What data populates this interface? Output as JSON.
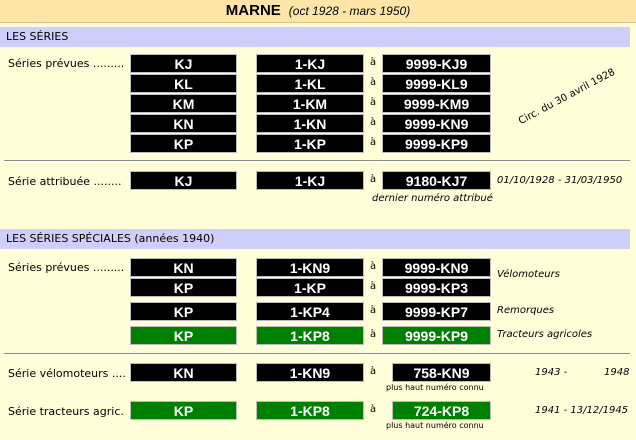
{
  "header": {
    "title": "MARNE",
    "dates": "(oct 1928 - mars 1950)"
  },
  "section1": {
    "heading": "LES SÉRIES",
    "series_prevues_label": "Séries prévues .........",
    "rows": [
      {
        "serie": "KJ",
        "from": "1-KJ",
        "a": "à",
        "to": "9999-KJ9"
      },
      {
        "serie": "KL",
        "from": "1-KL",
        "a": "à",
        "to": "9999-KL9"
      },
      {
        "serie": "KM",
        "from": "1-KM",
        "a": "à",
        "to": "9999-KM9"
      },
      {
        "serie": "KN",
        "from": "1-KN",
        "a": "à",
        "to": "9999-KN9"
      },
      {
        "serie": "KP",
        "from": "1-KP",
        "a": "à",
        "to": "9999-KP9"
      }
    ],
    "circ_note": "Circ. du 30 avril 1928",
    "attribuee_label": "Série attribuée ........",
    "attribuee": {
      "serie": "KJ",
      "from": "1-KJ",
      "a": "à",
      "to": "9180-KJ7"
    },
    "attribuee_dates": "01/10/1928 - 31/03/1950",
    "dernier_note": "dernier numéro attribué"
  },
  "section2": {
    "heading": "LES SÉRIES SPÉCIALES (années 1940)",
    "series_prevues_label": "Séries prévues .........",
    "rows": [
      {
        "serie": "KN",
        "from": "1-KN9",
        "a": "à",
        "to": "9999-KN9",
        "color": "black"
      },
      {
        "serie": "KP",
        "from": "1-KP",
        "a": "à",
        "to": "9999-KP3",
        "color": "black"
      },
      {
        "serie": "KP",
        "from": "1-KP4",
        "a": "à",
        "to": "9999-KP7",
        "color": "black"
      },
      {
        "serie": "KP",
        "from": "1-KP8",
        "a": "à",
        "to": "9999-KP9",
        "color": "green"
      }
    ],
    "velomoteurs_note": "Vélomoteurs",
    "remorques_note": "Remorques",
    "tracteurs_note": "Tracteurs agricoles",
    "velo_label": "Série vélomoteurs ....",
    "velo": {
      "serie": "KN",
      "from": "1-KN9",
      "a": "à",
      "to": "758-KN9"
    },
    "velo_note": "plus haut numéro connu",
    "velo_date_start": "1943 -",
    "velo_date_end": "1948",
    "tract_label": "Série tracteurs agric.",
    "tract": {
      "serie": "KP",
      "from": "1-KP8",
      "a": "à",
      "to": "724-KP8"
    },
    "tract_note": "plus haut numéro connu",
    "tract_dates": "1941 - 13/12/1945"
  },
  "colors": {
    "background": "#fffed9",
    "title_bar": "#ffe6a8",
    "section_bar": "#cfcffb",
    "plate_black": "#000000",
    "plate_green": "#008000"
  }
}
